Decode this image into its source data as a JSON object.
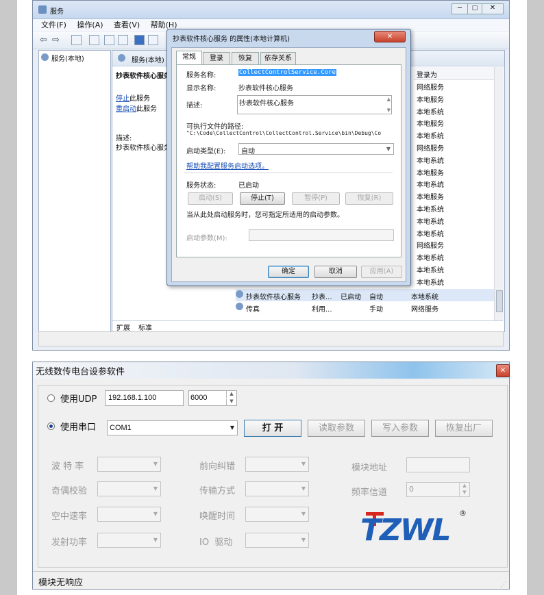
{
  "services_window": {
    "title": "服务",
    "menu": [
      "文件(F)",
      "操作(A)",
      "查看(V)",
      "帮助(H)"
    ],
    "tree_item": "服务(本地)",
    "pane_header": "服务(本地)",
    "selected_service_name": "抄表软件核心服务",
    "stop_link": "停止",
    "stop_suffix": "此服务",
    "restart_link": "重启动",
    "restart_suffix": "此服务",
    "desc_label": "描述:",
    "desc_text": "抄表软件核心服务",
    "col_logon": "登录为",
    "logon_values": [
      "网络服务",
      "本地服务",
      "本地系统",
      "本地服务",
      "本地系统",
      "网络服务",
      "本地系统",
      "本地服务",
      "本地系统",
      "本地服务",
      "本地系统",
      "本地系统",
      "本地系统",
      "网络服务",
      "本地系统",
      "本地系统",
      "本地系统",
      "本地系统"
    ],
    "rows": [
      {
        "name": "抄表软件核心服务",
        "desc": "抄表...",
        "status": "已启动",
        "startup": "自动",
        "logon": "本地系统"
      },
      {
        "name": "传真",
        "desc": "利用...",
        "status": "",
        "startup": "手动",
        "logon": "网络服务"
      }
    ],
    "tabs": [
      "扩展",
      "标准"
    ]
  },
  "properties_dialog": {
    "title": "抄表软件核心服务 的属性(本地计算机)",
    "tabs": [
      "常规",
      "登录",
      "恢复",
      "依存关系"
    ],
    "service_name_label": "服务名称:",
    "service_name_value": "CollectControlService.Core",
    "display_name_label": "显示名称:",
    "display_name_value": "抄表软件核心服务",
    "description_label": "描述:",
    "description_value": "抄表软件核心服务",
    "exe_path_label": "可执行文件的路径:",
    "exe_path_value": "\"C:\\Code\\CollectControl\\CollectControl.Service\\bin\\Debug\\Co",
    "startup_type_label": "启动类型(E):",
    "startup_type_value": "自动",
    "help_link": "帮助我配置服务启动选项。",
    "status_label": "服务状态:",
    "status_value": "已启动",
    "btn_start": "启动(S)",
    "btn_stop": "停止(T)",
    "btn_pause": "暂停(P)",
    "btn_resume": "恢复(R)",
    "start_params_hint": "当从此处启动服务时，您可指定所适用的启动参数。",
    "start_params_label": "启动参数(M):",
    "btn_ok": "确定",
    "btn_cancel": "取消",
    "btn_apply": "应用(A)"
  },
  "config_window": {
    "title": "无线数传电台设参软件",
    "udp_label": "使用UDP",
    "ip_value": "192.168.1.100",
    "port_value": "6000",
    "serial_label": "使用串口",
    "com_value": "COM1",
    "btn_open": "打 开",
    "btn_read": "读取参数",
    "btn_write": "写入参数",
    "btn_restore": "恢复出厂",
    "labels_col1": [
      "波 特 率",
      "奇偶校验",
      "空中速率",
      "发射功率"
    ],
    "labels_col2": [
      "前向纠错",
      "传输方式",
      "唤醒时间",
      "IO  驱动"
    ],
    "module_addr_label": "模块地址",
    "freq_channel_label": "频率信道",
    "freq_channel_value": "0",
    "logo_text": "TZWL",
    "logo_mark": "®",
    "status_text": "模块无响应"
  },
  "colors": {
    "link": "#1a4fb5",
    "logo_blue": "#1f5fb8",
    "logo_red": "#d7261e",
    "selection": "#3399ff"
  }
}
